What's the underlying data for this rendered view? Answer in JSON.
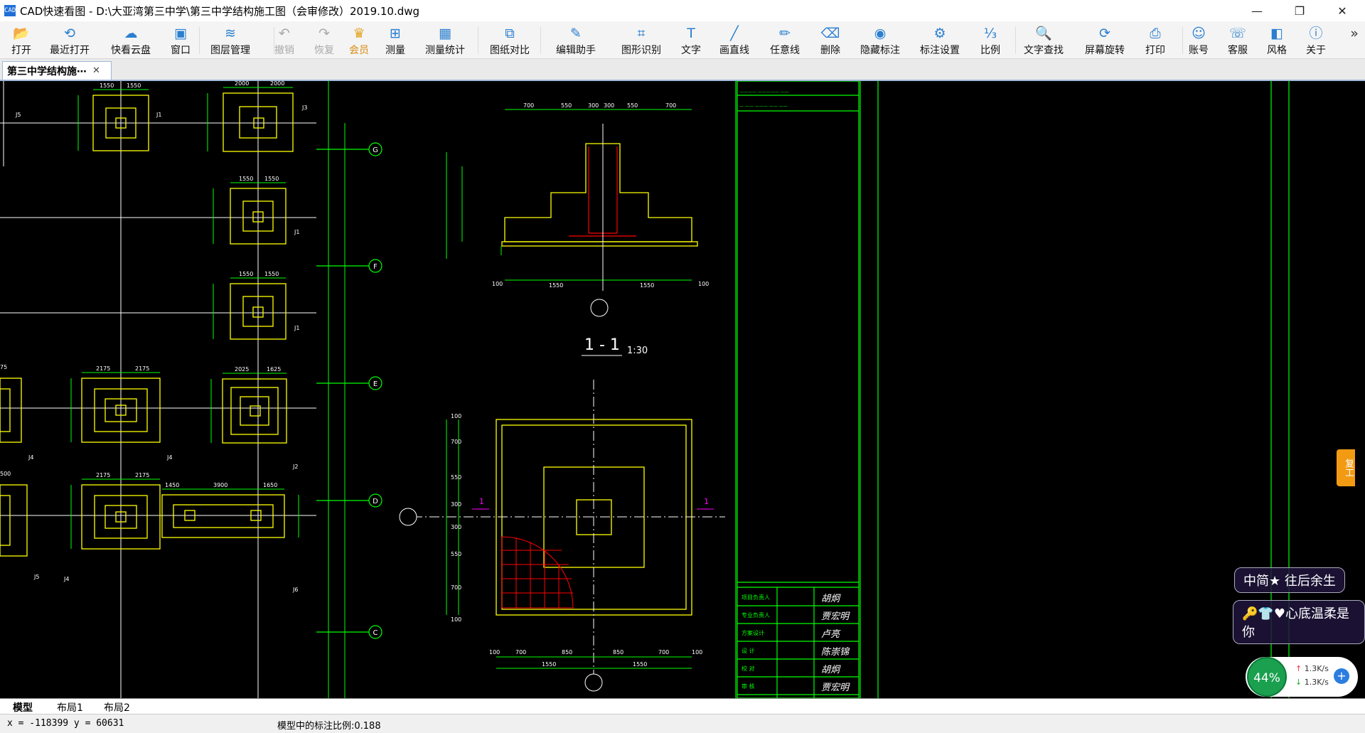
{
  "window": {
    "title": "CAD快速看图 - D:\\大亚湾第三中学\\第三中学结构施工图（会审修改）2019.10.dwg",
    "app_icon": "cad-app-icon",
    "controls": [
      "minimize-icon",
      "restore-icon",
      "close-icon"
    ],
    "control_glyphs": {
      "minimize": "—",
      "restore": "❐",
      "close": "✕"
    }
  },
  "toolbar": {
    "items": [
      {
        "label": "打开",
        "icon": "folder-open-icon",
        "glyph": "📂"
      },
      {
        "label": "最近打开",
        "icon": "clock-icon",
        "glyph": "⟲"
      },
      {
        "label": "快看云盘",
        "icon": "cloud-icon",
        "glyph": "☁"
      },
      {
        "label": "窗口",
        "icon": "window-icon",
        "glyph": "▣"
      },
      {
        "label": "图层管理",
        "icon": "layers-icon",
        "glyph": "≋"
      },
      {
        "label": "撤销",
        "icon": "undo-icon",
        "glyph": "↶",
        "disabled": true
      },
      {
        "label": "恢复",
        "icon": "redo-icon",
        "glyph": "↷",
        "disabled": true
      },
      {
        "label": "会员",
        "icon": "vip-icon",
        "glyph": "♛",
        "vip": true
      },
      {
        "label": "测量",
        "icon": "ruler-icon",
        "glyph": "⊞"
      },
      {
        "label": "测量统计",
        "icon": "measure-stats-icon",
        "glyph": "▦"
      },
      {
        "label": "图纸对比",
        "icon": "compare-icon",
        "glyph": "⧉"
      },
      {
        "label": "编辑助手",
        "icon": "edit-assistant-icon",
        "glyph": "✎"
      },
      {
        "label": "图形识别",
        "icon": "shape-recognize-icon",
        "glyph": "⌗"
      },
      {
        "label": "文字",
        "icon": "text-icon",
        "glyph": "T"
      },
      {
        "label": "画直线",
        "icon": "line-icon",
        "glyph": "╱"
      },
      {
        "label": "任意线",
        "icon": "freehand-icon",
        "glyph": "✏"
      },
      {
        "label": "删除",
        "icon": "eraser-icon",
        "glyph": "⌫"
      },
      {
        "label": "隐藏标注",
        "icon": "hide-eye-icon",
        "glyph": "◉"
      },
      {
        "label": "标注设置",
        "icon": "annotation-settings-icon",
        "glyph": "⚙"
      },
      {
        "label": "比例",
        "icon": "scale-icon",
        "glyph": "⅓"
      },
      {
        "label": "文字查找",
        "icon": "text-search-icon",
        "glyph": "🔍"
      },
      {
        "label": "屏幕旋转",
        "icon": "rotate-screen-icon",
        "glyph": "⟳"
      },
      {
        "label": "打印",
        "icon": "printer-icon",
        "glyph": "⎙"
      },
      {
        "label": "账号",
        "icon": "user-icon",
        "glyph": "☺"
      },
      {
        "label": "客服",
        "icon": "headset-icon",
        "glyph": "☏"
      },
      {
        "label": "风格",
        "icon": "style-icon",
        "glyph": "◧"
      },
      {
        "label": "关于",
        "icon": "info-icon",
        "glyph": "ⓘ"
      }
    ],
    "more_glyph": "»"
  },
  "document_tab": {
    "label": "第三中学结构施⋯",
    "close": "✕"
  },
  "drawing": {
    "grid_labels": [
      "G",
      "F",
      "E",
      "D",
      "C"
    ],
    "foundation_labels": [
      "J1",
      "J3",
      "J1",
      "J1",
      "J4",
      "J2",
      "J5",
      "J4",
      "J6",
      "J4",
      "J5"
    ],
    "section_title": "1 - 1",
    "section_scale": "1:30",
    "dims_top": [
      "700",
      "550",
      "300",
      "300",
      "550",
      "700"
    ],
    "dims_bottom_section": [
      "100",
      "1550",
      "1550",
      "100"
    ],
    "dims_plan_bottom": [
      "100",
      "700",
      "850",
      "850",
      "700",
      "100"
    ],
    "dims_plan_bottom2": [
      "1550",
      "1550"
    ],
    "dims_plan_left": [
      "100",
      "700",
      "550",
      "300",
      "300",
      "550",
      "700",
      "100"
    ],
    "section_mark": "1",
    "sig_rows": [
      "项目负责人",
      "专业负责人",
      "方案设计",
      "设 计",
      "校 对",
      "审 核"
    ],
    "sig_names": [
      "胡炯",
      "贾宏明",
      "卢亮",
      "陈崇锦",
      "胡炯",
      "贾宏明"
    ]
  },
  "layout_tabs": [
    "模型",
    "布局1",
    "布局2"
  ],
  "status": {
    "coords": "x = -118399 y = 60631",
    "scale_text": "模型中的标注比例:0.188"
  },
  "overlays": {
    "ime_1": "中简★ 往后余生",
    "ime_2": "🔑👕♥心底温柔是你",
    "side_badge": "复工",
    "speed_percent": "44%",
    "upload": "1.3K/s",
    "download": "1.3K/s",
    "plus": "+"
  },
  "colors": {
    "canvas": "#000000",
    "cad_green": "#00ff00",
    "cad_yellow": "#ffff00",
    "cad_white": "#ffffff",
    "cad_red": "#ff0000",
    "cad_magenta": "#ff00ff"
  }
}
